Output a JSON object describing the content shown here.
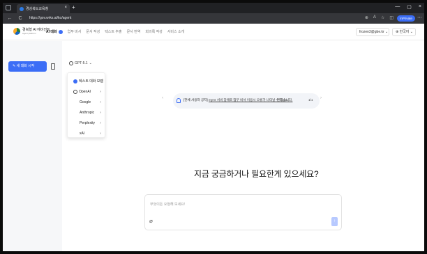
{
  "browser": {
    "tab_title": "경상북도교육청",
    "close_glyph": "×",
    "new_tab_glyph": "+",
    "window_controls": [
      "—",
      "▢",
      "×"
    ],
    "nav_back": "←",
    "nav_reload": "C",
    "url": "https://gov.wrks.ai/ko/agent",
    "ext_icons": [
      "⊕",
      "A",
      "☆",
      "◫"
    ],
    "inprivate_label": "InPrivate",
    "menu_glyph": "⋯"
  },
  "header": {
    "logo_text": "경북형 AI 에이전트",
    "logo_sub": "Agent platform",
    "menu_items": [
      "AI 대화",
      "업무 비서",
      "문서 작성",
      "텍스트 추출",
      "문서 번역",
      "회의록 작성",
      "서비스 소개"
    ],
    "account": "frozen3@gbe.kr",
    "account_caret": "⌄",
    "language": "한국어",
    "language_caret": "⌄"
  },
  "sidebar": {
    "new_chat_label": "새 대화 시작"
  },
  "model_selector": {
    "label": "GPT-5.1",
    "caret": "⌄",
    "options": [
      {
        "label": "텍스트 대화 모델",
        "chevron": "›"
      },
      {
        "label": "OpenAI",
        "chevron": "›"
      },
      {
        "label": "Google",
        "chevron": "›"
      },
      {
        "label": "Anthropic",
        "chevron": "›"
      },
      {
        "label": "Perplexity",
        "chevron": "›"
      },
      {
        "label": "xAI",
        "chevron": "›"
      }
    ]
  },
  "notice": {
    "prev_glyph": "‹",
    "next_glyph": "›",
    "prefix": "[전체 사용자 공지]",
    "message": "myAI 서비 장애로 업무 비서 이용시 오류가 나타날 수 있습니다.",
    "link": "현재 Cu",
    "page": "1/1"
  },
  "main": {
    "headline": "지금 궁금하거나 필요한게 있으세요?",
    "input_placeholder": "무엇이든 요청해 보세요!",
    "attach_glyph": "⌀",
    "send_glyph": "↑"
  },
  "colors": {
    "accent": "#3b6df6",
    "tabbar": "#202124",
    "addressbar": "#35363a"
  }
}
